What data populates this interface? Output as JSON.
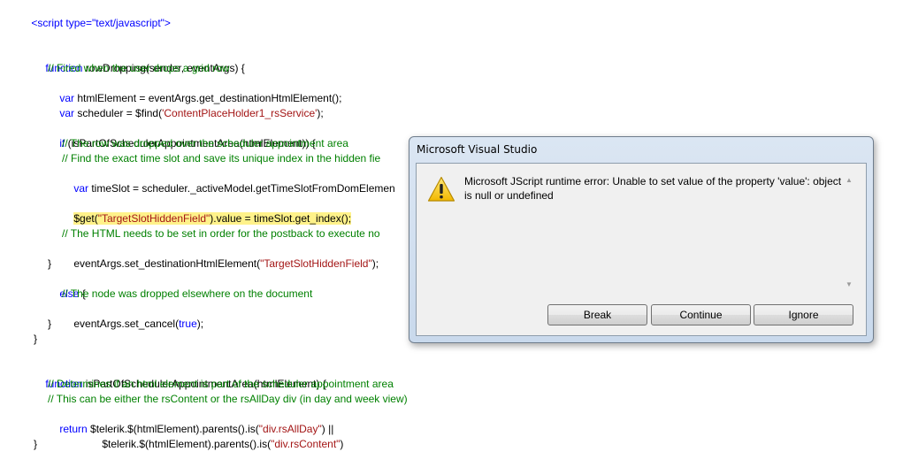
{
  "code": {
    "line_script": "<script type=\"text/javascript\">",
    "fn1_kw": "function",
    "fn1_sig": " rowDropping(sender, eventArgs) {",
    "c1": "// Fired when the user drops a grid row",
    "l3_kw": "var",
    "l3_rest": " htmlElement = eventArgs.get_destinationHtmlElement();",
    "l4_kw": "var",
    "l4_rest": " scheduler = $find(",
    "l4_str": "'ContentPlaceHolder1_rsService'",
    "l4_end": ");",
    "l6_kw": "if",
    "l6_rest": " (isPartOfSchedulerAppointmentArea(htmlElement)) {",
    "c2": "// The row was dropped over the scheduler appointment area",
    "c3": "// Find the exact time slot and save its unique index in the hidden fie",
    "l9_kw": "var",
    "l9_rest": " timeSlot = scheduler._activeModel.getTimeSlotFromDomElemen",
    "hl_a": "$get(",
    "hl_str": "\"TargetSlotHiddenField\"",
    "hl_b": ").value = timeSlot.get_index();",
    "c4": "// The HTML needs to be set in order for the postback to execute no",
    "l14_a": "eventArgs.set_destinationHtmlElement(",
    "l14_str": "\"TargetSlotHiddenField\"",
    "l14_b": ");",
    "brace_close": "}",
    "else_kw": "else",
    "else_rest": " {",
    "c5": "// The node was dropped elsewhere on the document",
    "l18_a": "eventArgs.set_cancel(",
    "l18_kw": "true",
    "l18_b": ");",
    "fn2_kw": "function",
    "fn2_sig": " isPartOfSchedulerAppointmentArea(htmlElement) {",
    "c6": "// Determines if an html element is part of the scheduler appointment area",
    "c7": "// This can be either the rsContent or the rsAllDay div (in day and week view)",
    "ret_kw": "return",
    "ret_a": " $telerik.$(htmlElement).parents().is(",
    "ret_str": "\"div.rsAllDay\"",
    "ret_b": ") ||",
    "cont_a": "$telerik.$(htmlElement).parents().is(",
    "cont_str": "\"div.rsContent\"",
    "cont_b": ")"
  },
  "dialog": {
    "title": "Microsoft Visual Studio",
    "message": "Microsoft JScript runtime error: Unable to set value of the property 'value': object is null or undefined",
    "buttons": {
      "break": "Break",
      "continue": "Continue",
      "ignore": "Ignore"
    },
    "icon": "warning-icon"
  },
  "colors": {
    "keyword": "#0000ff",
    "comment": "#008000",
    "string": "#a31515",
    "highlight": "#fff28a"
  }
}
